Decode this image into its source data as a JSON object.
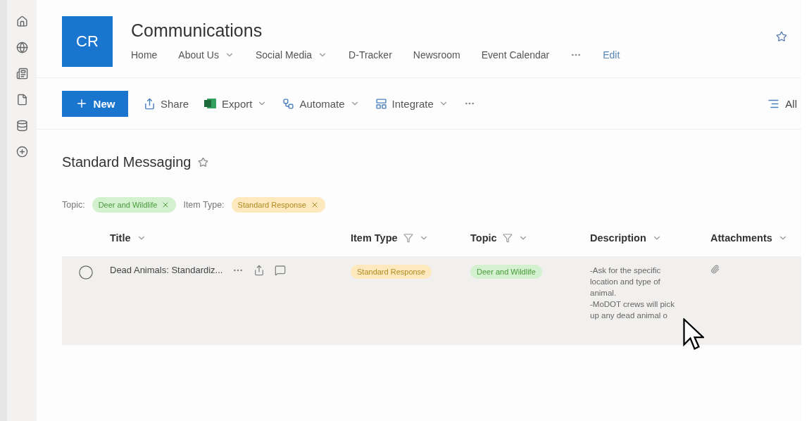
{
  "rail": [
    {
      "kind": "home"
    },
    {
      "kind": "globe"
    },
    {
      "kind": "news"
    },
    {
      "kind": "file"
    },
    {
      "kind": "list"
    },
    {
      "kind": "add"
    }
  ],
  "site": {
    "logo": "CR",
    "title": "Communications",
    "nav": [
      {
        "label": "Home",
        "dropdown": false
      },
      {
        "label": "About Us",
        "dropdown": true
      },
      {
        "label": "Social Media",
        "dropdown": true
      },
      {
        "label": "D-Tracker",
        "dropdown": false
      },
      {
        "label": "Newsroom",
        "dropdown": false
      },
      {
        "label": "Event Calendar",
        "dropdown": false
      }
    ],
    "edit": "Edit"
  },
  "toolbar": [
    {
      "kind": "new",
      "label": "New"
    },
    {
      "kind": "share",
      "label": "Share",
      "dropdown": false
    },
    {
      "kind": "export",
      "label": "Export",
      "dropdown": true
    },
    {
      "kind": "automate",
      "label": "Automate",
      "dropdown": true
    },
    {
      "kind": "integrate",
      "label": "Integrate",
      "dropdown": true
    }
  ],
  "view": {
    "label": "All"
  },
  "list": {
    "title": "Standard Messaging",
    "filters": [
      {
        "label": "Topic:",
        "value": "Deer and Wildlife",
        "color": "#d3f1cf"
      },
      {
        "label": "Item Type:",
        "value": "Standard Response",
        "color": "#fde9bd"
      }
    ],
    "columns": [
      {
        "label": "Title",
        "filtered": false
      },
      {
        "label": "Item Type",
        "filtered": true
      },
      {
        "label": "Topic",
        "filtered": true
      },
      {
        "label": "Description",
        "filtered": false
      },
      {
        "label": "Attachments",
        "filtered": false
      }
    ],
    "rows": [
      {
        "selected": false,
        "title": "Dead Animals: Standardiz...",
        "item_type": {
          "label": "Standard Response",
          "color": "#fde9bd"
        },
        "topic": {
          "label": "Deer and Wildlife",
          "color": "#d3f1cf"
        },
        "description": [
          "-Ask for the specific location and type of animal.",
          "-MoDOT crews will pick up any dead animal o"
        ],
        "attachment": true
      }
    ]
  }
}
